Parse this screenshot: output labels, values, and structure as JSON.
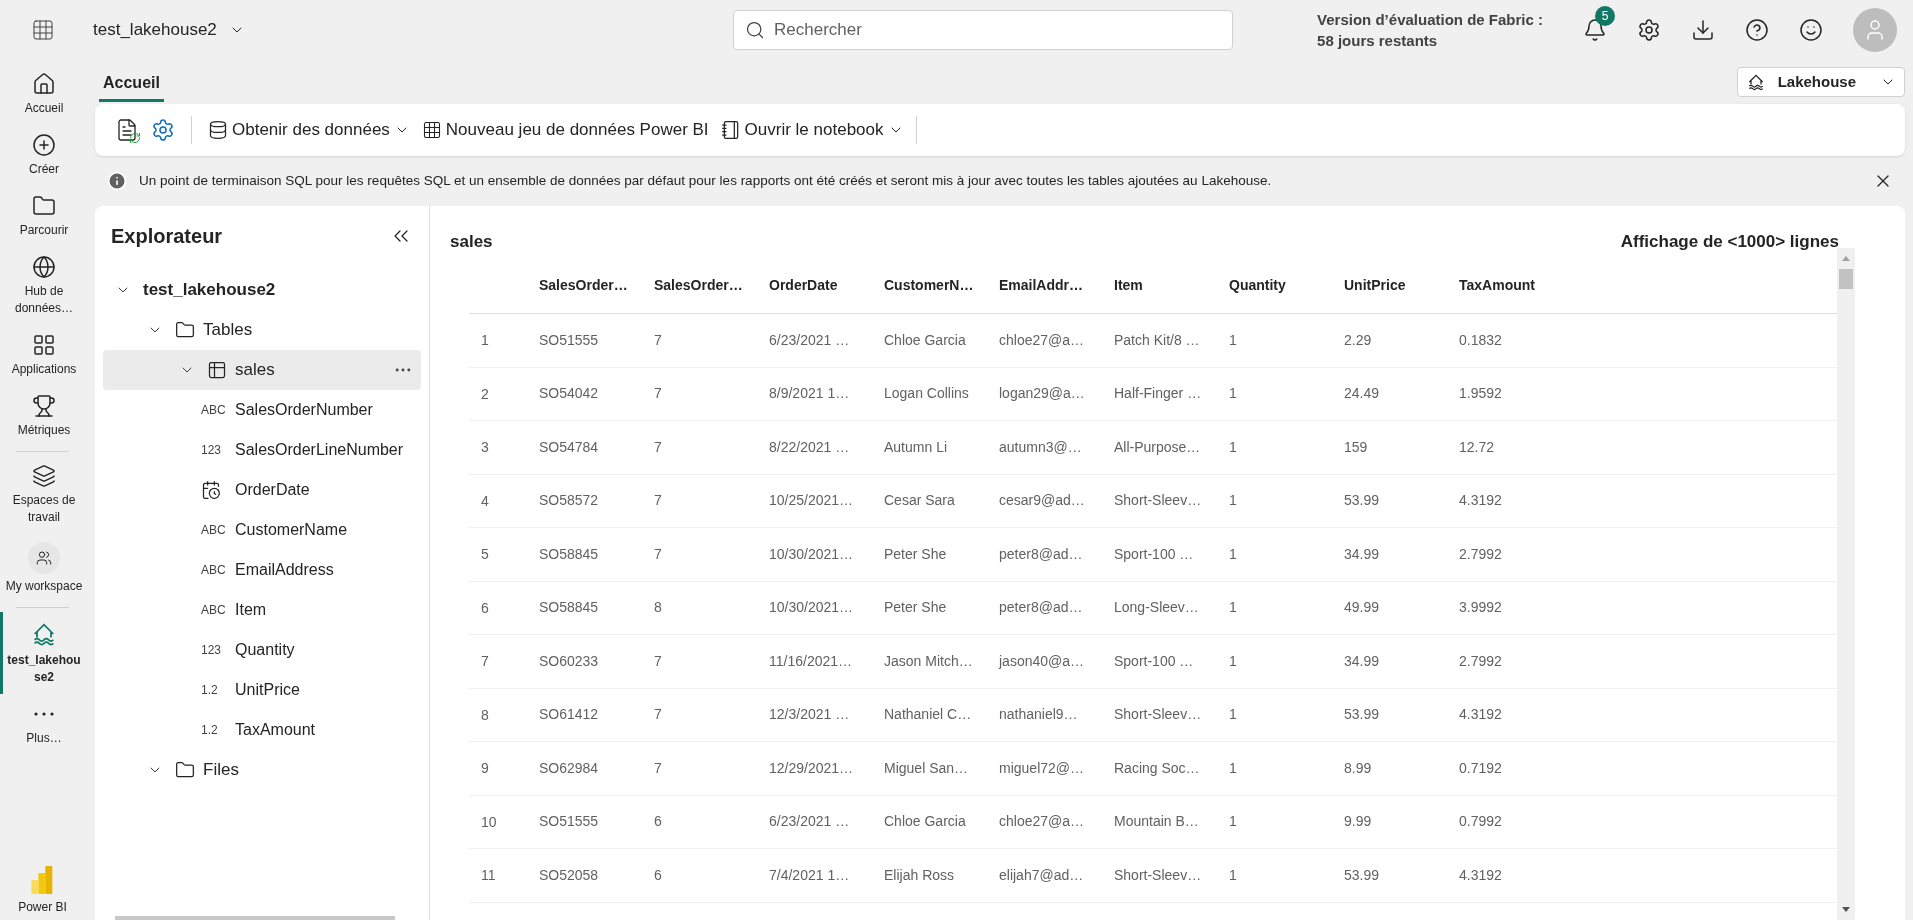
{
  "top_bar": {
    "workspace_title": "test_lakehouse2",
    "search": {
      "placeholder": "Rechercher"
    },
    "trial_line_1": "Version d’évaluation de Fabric :",
    "trial_line_2": "58 jours restants",
    "notification_count": "5"
  },
  "nav": [
    {
      "kind": "home",
      "label": "Accueil",
      "selected": false
    },
    {
      "kind": "create",
      "label": "Créer",
      "selected": false
    },
    {
      "kind": "browse",
      "label": "Parcourir",
      "selected": false
    },
    {
      "kind": "hub",
      "label": "Hub de données…",
      "selected": false
    },
    {
      "kind": "apps",
      "label": "Applications",
      "selected": false
    },
    {
      "kind": "metrics",
      "label": "Métriques",
      "selected": false
    },
    {
      "kind": "workspaces",
      "label": "Espaces de travail",
      "selected": false
    },
    {
      "kind": "myworkspace",
      "label": "My workspace",
      "selected": false
    },
    {
      "kind": "lakehouse",
      "label": "test_lakehouse2",
      "selected": true
    },
    {
      "kind": "more",
      "label": "Plus…",
      "selected": false
    }
  ],
  "nav_footer": "Power BI",
  "tabs": [
    {
      "label": "Accueil",
      "selected": true
    }
  ],
  "view_switcher": "Lakehouse",
  "toolbar": [
    {
      "kind": "refresh"
    },
    {
      "kind": "settings"
    },
    {
      "kind": "get_data",
      "label": "Obtenir des données",
      "dropdown": true
    },
    {
      "kind": "dataset",
      "label": "Nouveau jeu de données Power BI",
      "dropdown": false
    },
    {
      "kind": "notebook",
      "label": "Ouvrir le notebook",
      "dropdown": true
    }
  ],
  "info_message": "Un point de terminaison SQL pour les requêtes SQL et un ensemble de données par défaut pour les rapports ont été créés et seront mis à jour avec toutes les tables ajoutées au Lakehouse.",
  "explorer": {
    "title": "Explorateur",
    "tree": [
      {
        "kind": "lakehouse",
        "label": "test_lakehouse2",
        "expanded": true,
        "selected": false,
        "children": [
          {
            "kind": "folder",
            "label": "Tables",
            "expanded": true,
            "selected": false,
            "children": [
              {
                "kind": "table",
                "label": "sales",
                "expanded": true,
                "selected": true,
                "children": [
                  {
                    "kind": "column",
                    "type_label": "ABC",
                    "label": "SalesOrderNumber",
                    "selected": false
                  },
                  {
                    "kind": "column",
                    "type_label": "123",
                    "label": "SalesOrderLineNumber",
                    "selected": false
                  },
                  {
                    "kind": "date_column",
                    "label": "OrderDate",
                    "selected": false
                  },
                  {
                    "kind": "column",
                    "type_label": "ABC",
                    "label": "CustomerName",
                    "selected": false
                  },
                  {
                    "kind": "column",
                    "type_label": "ABC",
                    "label": "EmailAddress",
                    "selected": false
                  },
                  {
                    "kind": "column",
                    "type_label": "ABC",
                    "label": "Item",
                    "selected": false
                  },
                  {
                    "kind": "column",
                    "type_label": "123",
                    "label": "Quantity",
                    "selected": false
                  },
                  {
                    "kind": "column",
                    "type_label": "1.2",
                    "label": "UnitPrice",
                    "selected": false
                  },
                  {
                    "kind": "column",
                    "type_label": "1.2",
                    "label": "TaxAmount",
                    "selected": false
                  }
                ]
              }
            ]
          },
          {
            "kind": "folder",
            "label": "Files",
            "expanded": true,
            "selected": false
          }
        ]
      }
    ]
  },
  "preview": {
    "title": "sales",
    "row_count": "Affichage de <1000> lignes",
    "columns": [
      "SalesOrder…",
      "SalesOrder…",
      "OrderDate",
      "CustomerN…",
      "EmailAddr…",
      "Item",
      "Quantity",
      "UnitPrice",
      "TaxAmount"
    ],
    "rows": [
      {
        "number": "1",
        "cells": [
          "SO51555",
          "7",
          "6/23/2021 …",
          "Chloe Garcia",
          "chloe27@a…",
          "Patch Kit/8 …",
          "1",
          "2.29",
          "0.1832"
        ]
      },
      {
        "number": "2",
        "cells": [
          "SO54042",
          "7",
          "8/9/2021 1…",
          "Logan Collins",
          "logan29@a…",
          "Half-Finger …",
          "1",
          "24.49",
          "1.9592"
        ]
      },
      {
        "number": "3",
        "cells": [
          "SO54784",
          "7",
          "8/22/2021 …",
          "Autumn Li",
          "autumn3@…",
          "All-Purpose…",
          "1",
          "159",
          "12.72"
        ]
      },
      {
        "number": "4",
        "cells": [
          "SO58572",
          "7",
          "10/25/2021…",
          "Cesar Sara",
          "cesar9@ad…",
          "Short-Sleev…",
          "1",
          "53.99",
          "4.3192"
        ]
      },
      {
        "number": "5",
        "cells": [
          "SO58845",
          "7",
          "10/30/2021…",
          "Peter She",
          "peter8@ad…",
          "Sport-100 …",
          "1",
          "34.99",
          "2.7992"
        ]
      },
      {
        "number": "6",
        "cells": [
          "SO58845",
          "8",
          "10/30/2021…",
          "Peter She",
          "peter8@ad…",
          "Long-Sleev…",
          "1",
          "49.99",
          "3.9992"
        ]
      },
      {
        "number": "7",
        "cells": [
          "SO60233",
          "7",
          "11/16/2021…",
          "Jason Mitch…",
          "jason40@a…",
          "Sport-100 …",
          "1",
          "34.99",
          "2.7992"
        ]
      },
      {
        "number": "8",
        "cells": [
          "SO61412",
          "7",
          "12/3/2021 …",
          "Nathaniel C…",
          "nathaniel9…",
          "Short-Sleev…",
          "1",
          "53.99",
          "4.3192"
        ]
      },
      {
        "number": "9",
        "cells": [
          "SO62984",
          "7",
          "12/29/2021…",
          "Miguel San…",
          "miguel72@…",
          "Racing Soc…",
          "1",
          "8.99",
          "0.7192"
        ]
      },
      {
        "number": "10",
        "cells": [
          "SO51555",
          "6",
          "6/23/2021 …",
          "Chloe Garcia",
          "chloe27@a…",
          "Mountain B…",
          "1",
          "9.99",
          "0.7992"
        ]
      },
      {
        "number": "11",
        "cells": [
          "SO52058",
          "6",
          "7/4/2021 1…",
          "Elijah Ross",
          "elijah7@ad…",
          "Short-Sleev…",
          "1",
          "53.99",
          "4.3192"
        ]
      }
    ]
  }
}
